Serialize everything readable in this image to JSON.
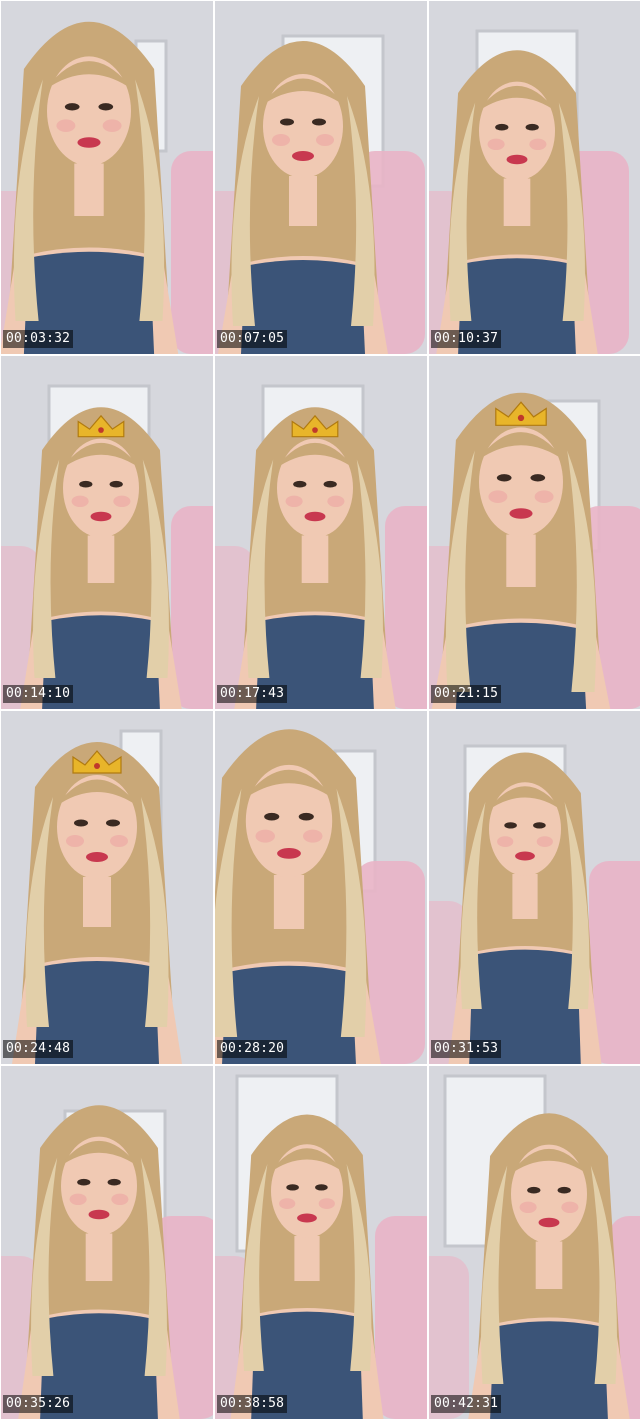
{
  "thumbnails": [
    {
      "timestamp": "00:03:32",
      "crown": false,
      "chair": true
    },
    {
      "timestamp": "00:07:05",
      "crown": false,
      "chair": true
    },
    {
      "timestamp": "00:10:37",
      "crown": false,
      "chair": true
    },
    {
      "timestamp": "00:14:10",
      "crown": true,
      "chair": true
    },
    {
      "timestamp": "00:17:43",
      "crown": true,
      "chair": true
    },
    {
      "timestamp": "00:21:15",
      "crown": true,
      "chair": true
    },
    {
      "timestamp": "00:24:48",
      "crown": true,
      "chair": false
    },
    {
      "timestamp": "00:28:20",
      "crown": false,
      "chair": true
    },
    {
      "timestamp": "00:31:53",
      "crown": false,
      "chair": true
    },
    {
      "timestamp": "00:35:26",
      "crown": false,
      "chair": true
    },
    {
      "timestamp": "00:38:58",
      "crown": false,
      "chair": true
    },
    {
      "timestamp": "00:42:31",
      "crown": false,
      "chair": true
    }
  ],
  "colors": {
    "wall": "#d6d7dd",
    "door": "#eef0f3",
    "hair": "#c9a878",
    "hair_light": "#e2cfa9",
    "skin": "#f0c9b3",
    "denim": "#3b5478",
    "chair": "#e9b4c6",
    "crown": "#e8b52a",
    "timestamp_bg": "#000000"
  }
}
